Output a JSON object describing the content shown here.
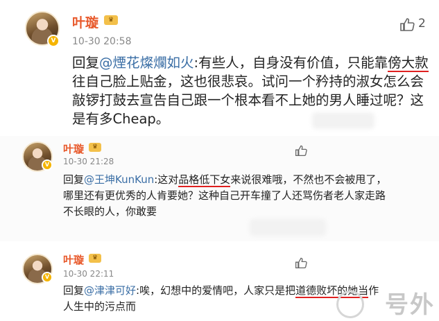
{
  "comments": [
    {
      "username": "叶璇",
      "timestamp": "10-30 20:58",
      "like_count": "2",
      "reply_prefix": "回复",
      "mention": "@煙花燦爛如火",
      "body": [
        ":有些人，自身没有价值，只能靠",
        "傍大款",
        "往自己脸上贴金，这也很悲哀。试问一个矜持的淑女怎么会敲锣打鼓去宣告自己跟一个根本看不上她的男人睡过呢？这是有多Cheap。"
      ]
    },
    {
      "username": "叶璇",
      "timestamp": "10-30 21:28",
      "like_count": "",
      "reply_prefix": "回复",
      "mention": "@王坤KunKun",
      "body": [
        ":这对",
        "品格低下女",
        "来说很难哦，不然也不会被甩了，哪里还有更优秀的人肯要她？这种自己开车撞了人还骂伤者老人家走路不长眼的人，你敢要"
      ]
    },
    {
      "username": "叶璇",
      "timestamp": "10-30 22:11",
      "like_count": "",
      "reply_prefix": "回复",
      "mention": "@津津可好",
      "body": [
        ":唉，幻想中的爱情吧，人家只是把",
        "道德败坏的她当",
        "作人生中的污点而"
      ]
    }
  ],
  "watermark": "号外",
  "colors": {
    "username": "#e8592b",
    "mention": "#3a6ea5",
    "underline": "#e02020"
  }
}
